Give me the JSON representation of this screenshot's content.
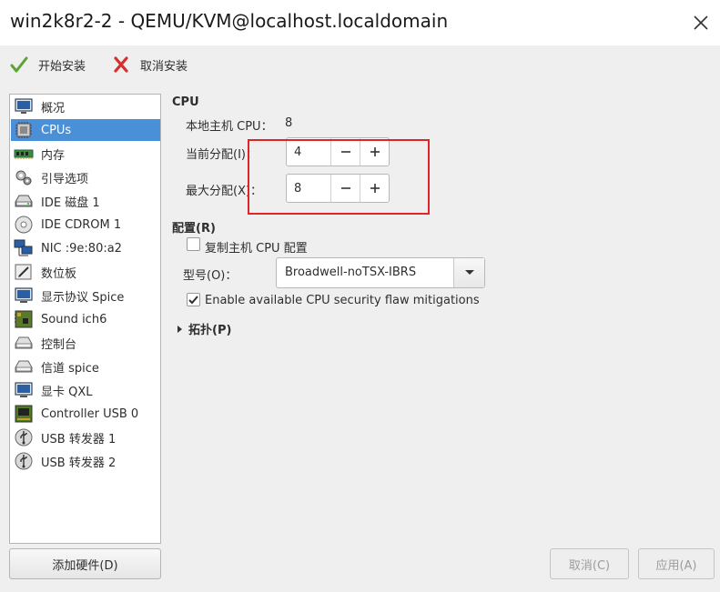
{
  "window": {
    "title": "win2k8r2-2 - QEMU/KVM@localhost.localdomain"
  },
  "toolbar": {
    "begin_install": "开始安装",
    "cancel_install": "取消安装"
  },
  "sidebar": {
    "items": [
      {
        "label": "概况",
        "icon": "overview-icon"
      },
      {
        "label": "CPUs",
        "icon": "cpu-chip-icon",
        "selected": true
      },
      {
        "label": "内存",
        "icon": "memory-icon"
      },
      {
        "label": "引导选项",
        "icon": "boot-options-icon"
      },
      {
        "label": "IDE 磁盘 1",
        "icon": "disk-icon"
      },
      {
        "label": "IDE CDROM 1",
        "icon": "cdrom-icon"
      },
      {
        "label": "NIC :9e:80:a2",
        "icon": "network-icon"
      },
      {
        "label": "数位板",
        "icon": "tablet-icon"
      },
      {
        "label": "显示协议 Spice",
        "icon": "display-icon"
      },
      {
        "label": "Sound ich6",
        "icon": "sound-icon"
      },
      {
        "label": "控制台",
        "icon": "console-icon"
      },
      {
        "label": "信道 spice",
        "icon": "channel-icon"
      },
      {
        "label": "显卡 QXL",
        "icon": "video-icon"
      },
      {
        "label": "Controller USB 0",
        "icon": "controller-icon"
      },
      {
        "label": "USB 转发器 1",
        "icon": "usb-icon"
      },
      {
        "label": "USB 转发器 2",
        "icon": "usb-icon"
      }
    ],
    "add_hardware": "添加硬件(D)"
  },
  "cpu": {
    "section_title": "CPU",
    "host_cpu_label": "本地主机 CPU：",
    "host_cpu_value": "8",
    "current_alloc_label": "当前分配(I)：",
    "current_alloc_value": "4",
    "max_alloc_label": "最大分配(X)：",
    "max_alloc_value": "8",
    "minus": "−",
    "plus": "+"
  },
  "config": {
    "section_title": "配置(R)",
    "copy_host_label": "复制主机 CPU 配置",
    "copy_host_checked": false,
    "model_label": "型号(O)：",
    "model_value": "Broadwell-noTSX-IBRS",
    "mitigations_label": "Enable available CPU security flaw mitigations",
    "mitigations_checked": true
  },
  "topology": {
    "label": "拓扑(P)"
  },
  "footer": {
    "cancel": "取消(C)",
    "apply": "应用(A)"
  },
  "colors": {
    "selection": "#4a90d9",
    "highlight_box": "#e0242a"
  }
}
